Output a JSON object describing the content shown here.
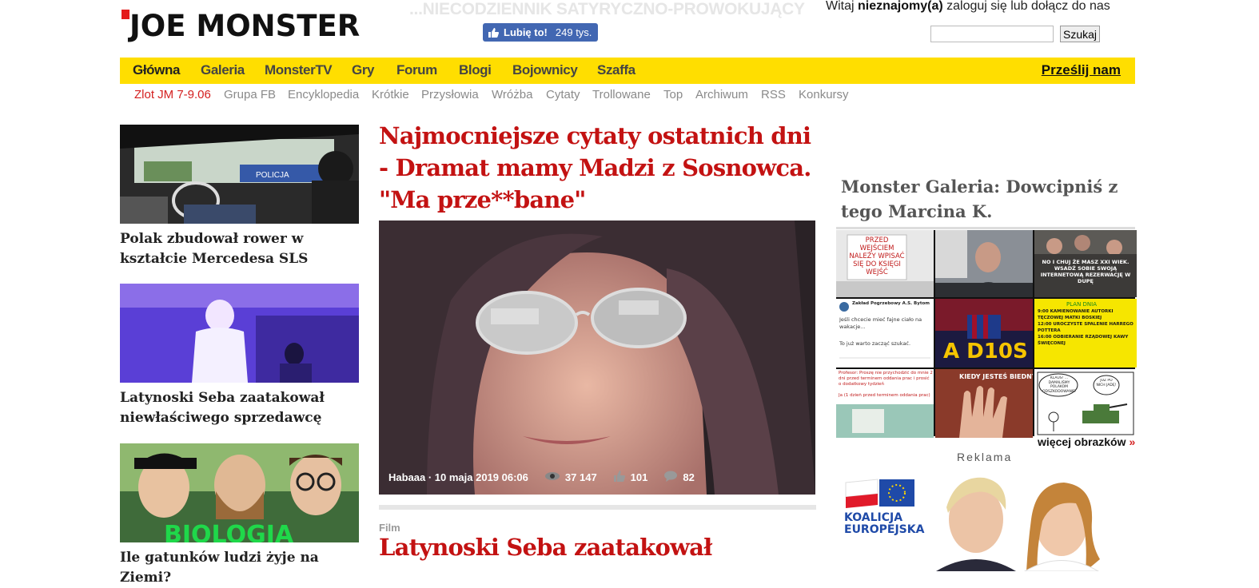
{
  "header": {
    "logo_text": "JOE MONSTER",
    "tagline": "...NIECODZIENNIK SATYRYCZNO-PROWOKUJĄCY",
    "fb_like_label": "Lubię to!",
    "fb_like_count": "249 tys.",
    "welcome_prefix": "Witaj",
    "welcome_user": "nieznajomy(a)",
    "welcome_suffix": "zaloguj się lub dołącz do nas",
    "search_placeholder": "",
    "search_button": "Szukaj"
  },
  "nav": {
    "items": [
      "Główna",
      "Galeria",
      "MonsterTV",
      "Gry",
      "Forum",
      "Blogi",
      "Bojownicy",
      "Szaffa"
    ],
    "send_label": "Prześlij nam"
  },
  "subnav": {
    "items": [
      "Zlot JM 7-9.06",
      "Grupa FB",
      "Encyklopedia",
      "Krótkie",
      "Przysłowia",
      "Wróżba",
      "Cytaty",
      "Trollowane",
      "Top",
      "Archiwum",
      "RSS",
      "Konkursy"
    ]
  },
  "left_articles": [
    {
      "title": "Polak zbudował rower w kształcie Mercedesa SLS"
    },
    {
      "title": "Latynoski Seba zaatakował niewłaściwego sprzedawcę"
    },
    {
      "title": "Ile gatunków ludzi żyje na Ziemi?"
    }
  ],
  "left_images": {
    "car_text": "POLICJA",
    "biologia_text": "BIOLOGIA"
  },
  "main": {
    "title": "Najmocniejsze cytaty ostatnich dni - Dramat mamy Madzi z Sosnowca. \"Ma prze**bane\"",
    "author_date": "Habaaa · 10 maja 2019 06:06",
    "views": "37 147",
    "likes": "101",
    "comments": "82",
    "category": "Film",
    "title2": "Latynoski Seba zaatakował"
  },
  "gallery": {
    "title": "Monster Galeria: Dowcipniś z tego Marcina K.",
    "more_label": "więcej obrazków",
    "more_arrow": "»",
    "cells": {
      "c1": "PRZED WEJŚCIEM NALEŻY WPISAĆ SIĘ DO KSIĘGI WEJŚĆ",
      "c3": "NO I CHUJ ŻE MASZ XXI WIEK. WSADŹ SOBIE SWOJĄ INTERNETOWĄ REZERWACJĘ W DUPĘ",
      "c4_name": "Zakład Pogrzebowy A.S. Bytom",
      "c4_text": "Jeśli chcecie mieć fajne ciało na wakacje...",
      "c4_text2": "To już warto zacząć szukać.",
      "c5": "A D10S",
      "c6_title": "PLAN DNIA",
      "c6_lines": [
        "9:00 KAMIENOWANIE AUTORKI TĘCZOWEJ MATKI BOSKIEJ",
        "12:00 UROCZYSTE SPALENIE HARREGO POTTERA",
        "16:00 ODBIERANIE RZĄDOWEJ KAWY ŚWIĘCONEJ"
      ],
      "c7_text": "Profesor: Proszę nie przychodzić do mnie 2 dni przed terminem oddania prac i prosić o dodatkowy tydzień",
      "c7_text2": "Ja (1 dzień przed terminem oddania prac)",
      "c8": "KIEDY JESTEŚ BIEDNY",
      "c9_a": "KLAUS! ... DAMALIŚMY POLAKOM ODSZKODOWANIE!",
      "c9_b": "JUŻ PO NICH JADĘ!"
    }
  },
  "ad": {
    "label": "Reklama",
    "brand_line1": "KOALICJA",
    "brand_line2": "EUROPEJSKA"
  },
  "colors": {
    "nav_bg": "#ffde00",
    "headline_red": "#c31212",
    "fb_blue": "#4267b2"
  }
}
